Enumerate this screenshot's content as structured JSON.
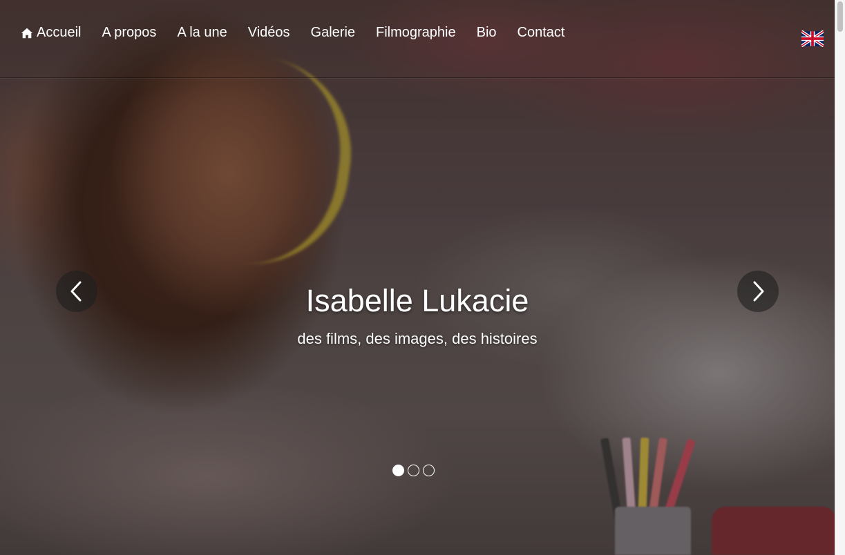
{
  "nav": {
    "items": [
      {
        "label": "Accueil",
        "icon": "home-icon"
      },
      {
        "label": "A propos"
      },
      {
        "label": "A la une"
      },
      {
        "label": "Vidéos"
      },
      {
        "label": "Galerie"
      },
      {
        "label": "Filmographie"
      },
      {
        "label": "Bio"
      },
      {
        "label": "Contact"
      }
    ],
    "language_flag": "uk-flag-icon"
  },
  "carousel": {
    "title": "Isabelle Lukacie",
    "subtitle": "des films, des images, des histoires",
    "prev_icon": "chevron-left-icon",
    "next_icon": "chevron-right-icon",
    "slide_count": 3,
    "active_slide": 1
  },
  "colors": {
    "text": "#ffffff",
    "arrow_bg": "#1e1e1e",
    "scrollbar_thumb": "#c1c1c1"
  }
}
